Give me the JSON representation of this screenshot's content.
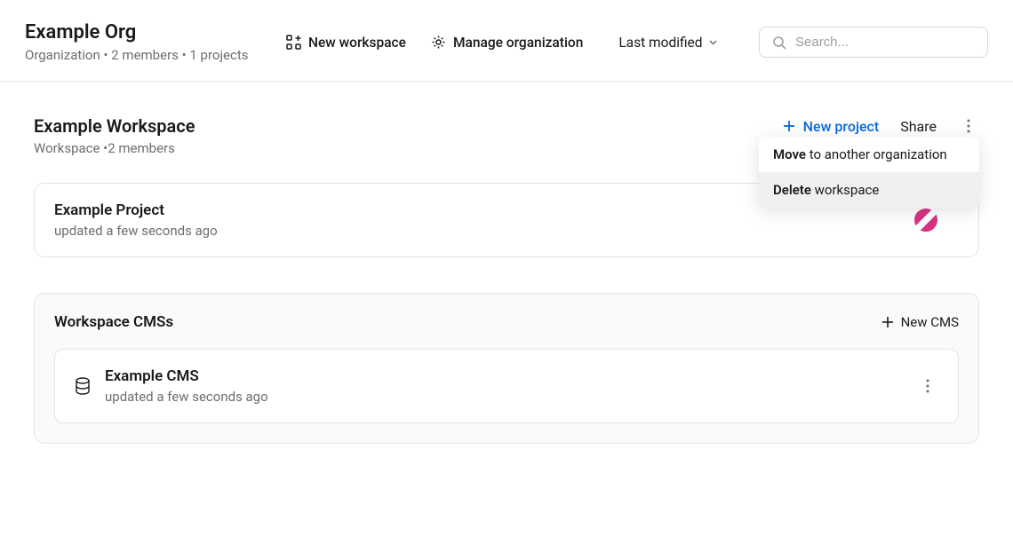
{
  "header": {
    "org_title": "Example Org",
    "org_meta": "Organization • 2 members • 1 projects",
    "new_workspace_label": "New workspace",
    "manage_org_label": "Manage organization",
    "sort_label": "Last modified",
    "search_placeholder": "Search..."
  },
  "workspace": {
    "title": "Example Workspace",
    "meta": "Workspace •2 members",
    "new_project_label": "New project",
    "share_label": "Share"
  },
  "project": {
    "title": "Example Project",
    "meta": "updated a few seconds ago"
  },
  "cms_section": {
    "title": "Workspace CMSs",
    "new_cms_label": "New CMS"
  },
  "cms": {
    "title": "Example CMS",
    "meta": "updated a few seconds ago"
  },
  "dropdown": {
    "move_bold": "Move",
    "move_rest": " to another organization",
    "delete_bold": "Delete",
    "delete_rest": " workspace"
  }
}
